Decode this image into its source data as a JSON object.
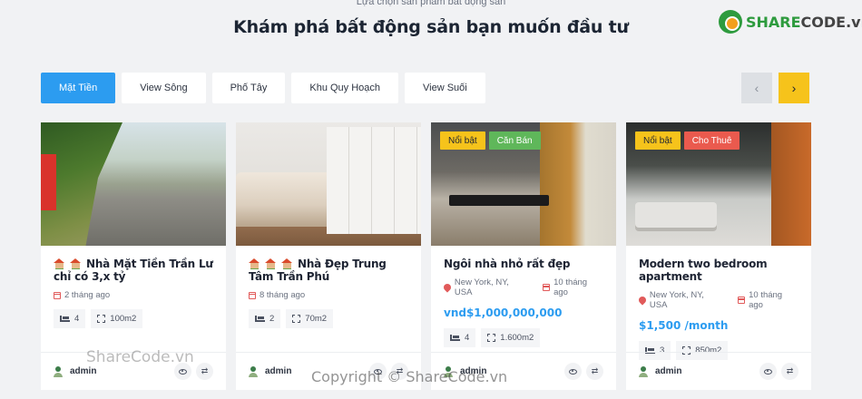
{
  "section": {
    "eyebrow": "Lựa chọn sản phẩm bất động sản",
    "title": "Khám phá bất động sản bạn muốn đầu tư"
  },
  "logo": {
    "brand": "SHARE",
    "suffix": "CODE.vn"
  },
  "tabs": [
    "Mặt Tiền",
    "View Sông",
    "Phố Tây",
    "Khu Quy Hoạch",
    "View Suối"
  ],
  "nav": {
    "prev_icon": "chevron-left-icon",
    "next_icon": "chevron-right-icon",
    "prev": "‹",
    "next": "›"
  },
  "listings": [
    {
      "title": "Nhà Mặt Tiền Trần Lư chỉ có 3,x tỷ",
      "time": "2 tháng ago",
      "beds": "4",
      "area": "100m2",
      "author": "admin"
    },
    {
      "title": "Nhà Đẹp Trung Tâm Trần Phú",
      "time": "8 tháng ago",
      "beds": "2",
      "area": "70m2",
      "author": "admin"
    },
    {
      "badges": [
        "Nổi bật",
        "Căn Bán"
      ],
      "title": "Ngôi nhà nhỏ rất đẹp",
      "location": "New York, NY, USA",
      "time": "10 tháng ago",
      "price": "vnd$1,000,000,000",
      "beds": "4",
      "area": "1.600m2",
      "author": "admin"
    },
    {
      "badges": [
        "Nổi bật",
        "Cho Thuê"
      ],
      "title": "Modern two bedroom apartment",
      "location": "New York, NY, USA",
      "time": "10 tháng ago",
      "price": "$1,500 /month",
      "beds": "3",
      "area": "850m2",
      "author": "admin"
    }
  ],
  "watermark": "ShareCode.vn",
  "copyright": "Copyright © ShareCode.vn",
  "colors": {
    "accent": "#2c9cf0",
    "yellow": "#f6c31b",
    "green": "#5fb75a",
    "red": "#ea5a4e"
  }
}
